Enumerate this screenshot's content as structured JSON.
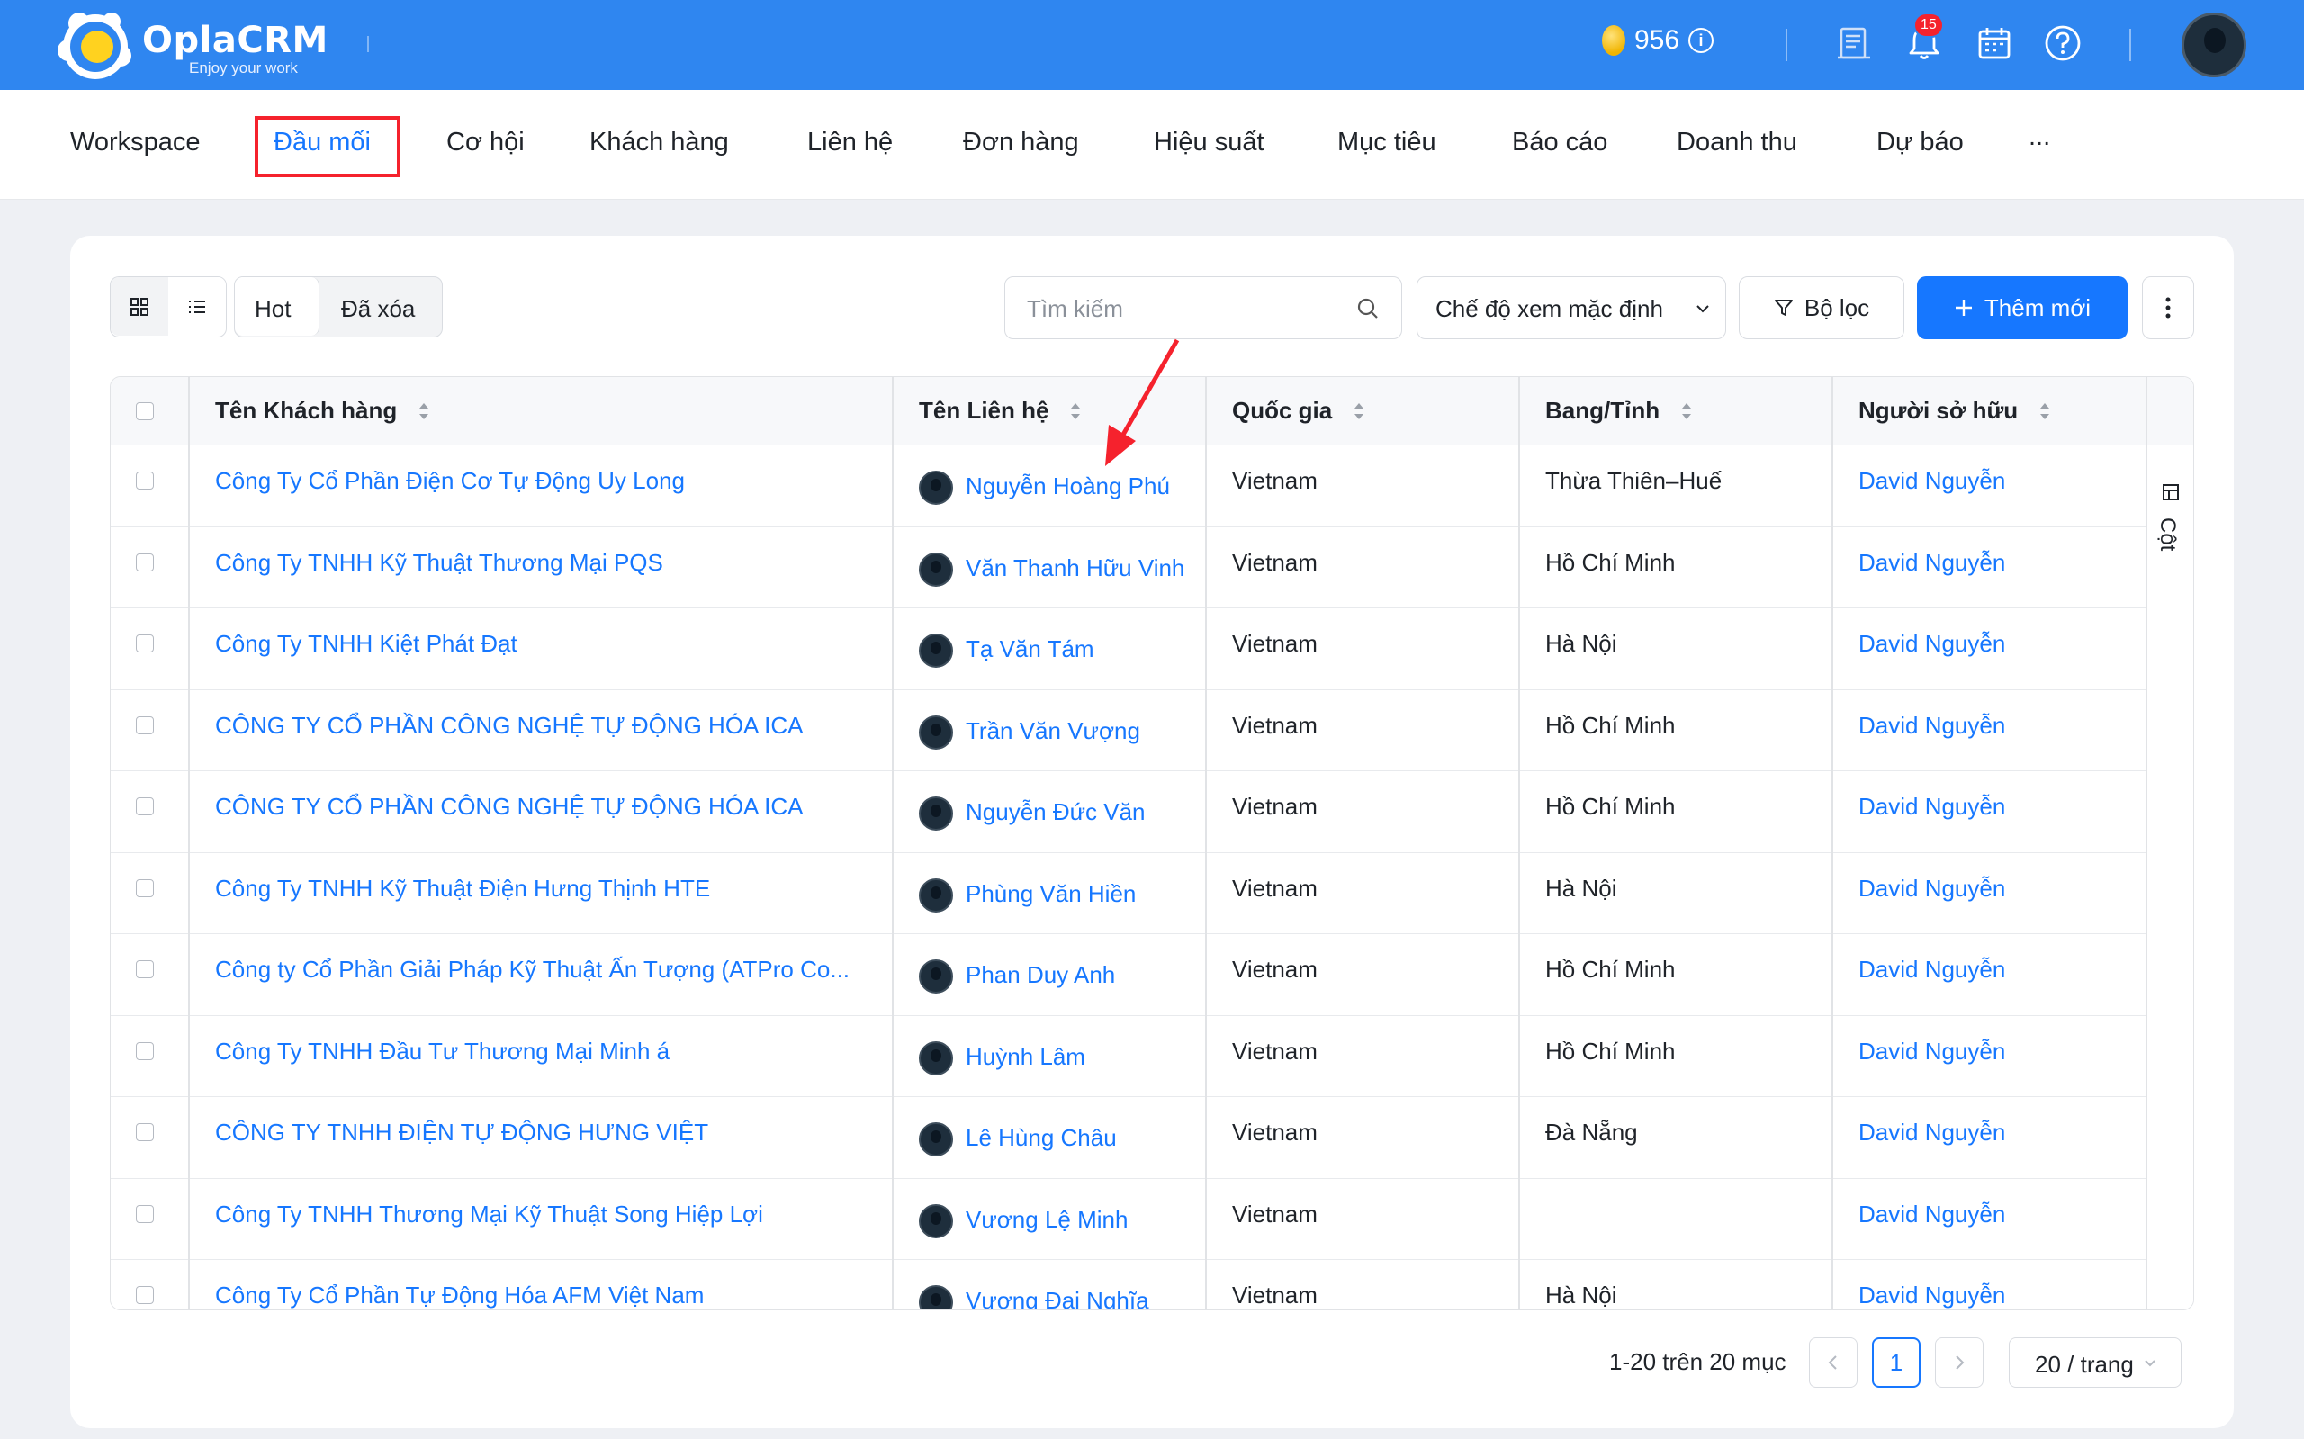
{
  "header": {
    "brand": "OplaCRM",
    "tagline": "Enjoy your work",
    "coins": "956",
    "notification_count": "15",
    "info_icon": "info-icon",
    "icons": [
      "report-icon",
      "bell-icon",
      "calendar-icon",
      "help-icon"
    ]
  },
  "nav": {
    "items": [
      "Workspace",
      "Đầu mối",
      "Cơ hội",
      "Khách hàng",
      "Liên hệ",
      "Đơn hàng",
      "Hiệu suất",
      "Mục tiêu",
      "Báo cáo",
      "Doanh thu",
      "Dự báo",
      "..."
    ],
    "active": "Đầu mối"
  },
  "toolbar": {
    "tabs": [
      "Hot",
      "Đã xóa"
    ],
    "search_placeholder": "Tìm kiếm",
    "view_mode": "Chế độ xem mặc định",
    "filter_label": "Bộ lọc",
    "add_label": "Thêm mới"
  },
  "table": {
    "columns": [
      "Tên Khách hàng",
      "Tên Liên hệ",
      "Quốc gia",
      "Bang/Tỉnh",
      "Người sở hữu"
    ],
    "side_label": "Cột",
    "rows": [
      {
        "company": "Công Ty Cổ Phần Điện Cơ Tự Động Uy Long",
        "contact": "Nguyễn Hoàng Phú",
        "country": "Vietnam",
        "state": "Thừa Thiên–Huế",
        "owner": "David Nguyễn"
      },
      {
        "company": "Công Ty TNHH Kỹ Thuật Thương Mại PQS",
        "contact": "Văn Thanh Hữu Vinh",
        "country": "Vietnam",
        "state": "Hồ Chí Minh",
        "owner": "David Nguyễn"
      },
      {
        "company": "Công Ty TNHH Kiệt Phát Đạt",
        "contact": "Tạ Văn Tám",
        "country": "Vietnam",
        "state": "Hà Nội",
        "owner": "David Nguyễn"
      },
      {
        "company": "CÔNG TY CỔ PHẦN CÔNG NGHỆ TỰ ĐỘNG HÓA ICA",
        "contact": "Trần Văn Vượng",
        "country": "Vietnam",
        "state": "Hồ Chí Minh",
        "owner": "David Nguyễn"
      },
      {
        "company": "CÔNG TY CỔ PHẦN CÔNG NGHỆ TỰ ĐỘNG HÓA ICA",
        "contact": "Nguyễn Đức Văn",
        "country": "Vietnam",
        "state": "Hồ Chí Minh",
        "owner": "David Nguyễn"
      },
      {
        "company": "Công Ty TNHH Kỹ Thuật Điện Hưng Thịnh HTE",
        "contact": "Phùng Văn Hiền",
        "country": "Vietnam",
        "state": "Hà Nội",
        "owner": "David Nguyễn"
      },
      {
        "company": "Công ty Cổ Phần Giải Pháp Kỹ Thuật Ấn Tượng (ATPro Co...",
        "contact": "Phan Duy Anh",
        "country": "Vietnam",
        "state": "Hồ Chí Minh",
        "owner": "David Nguyễn"
      },
      {
        "company": "Công Ty TNHH Đầu Tư Thương Mại Minh á",
        "contact": "Huỳnh Lâm",
        "country": "Vietnam",
        "state": "Hồ Chí Minh",
        "owner": "David Nguyễn"
      },
      {
        "company": "CÔNG TY TNHH ĐIỆN TỰ ĐỘNG HƯNG VIỆT",
        "contact": "Lê Hùng Châu",
        "country": "Vietnam",
        "state": "Đà Nẵng",
        "owner": "David Nguyễn"
      },
      {
        "company": "Công Ty TNHH Thương Mại Kỹ Thuật Song Hiệp Lợi",
        "contact": "Vương Lệ Minh",
        "country": "Vietnam",
        "state": "",
        "owner": "David Nguyễn"
      },
      {
        "company": "Công Ty Cổ Phần Tự Động Hóa AFM Việt Nam",
        "contact": "Vương Đại Nghĩa",
        "country": "Vietnam",
        "state": "Hà Nội",
        "owner": "David Nguyễn"
      }
    ]
  },
  "pagination": {
    "summary": "1-20 trên 20 mục",
    "current_page": "1",
    "page_size": "20 / trang"
  },
  "colors": {
    "primary": "#1677ff",
    "header_bg": "#2f86f0",
    "highlight": "#f5222d",
    "annotation_arrow": "#f5222d"
  }
}
